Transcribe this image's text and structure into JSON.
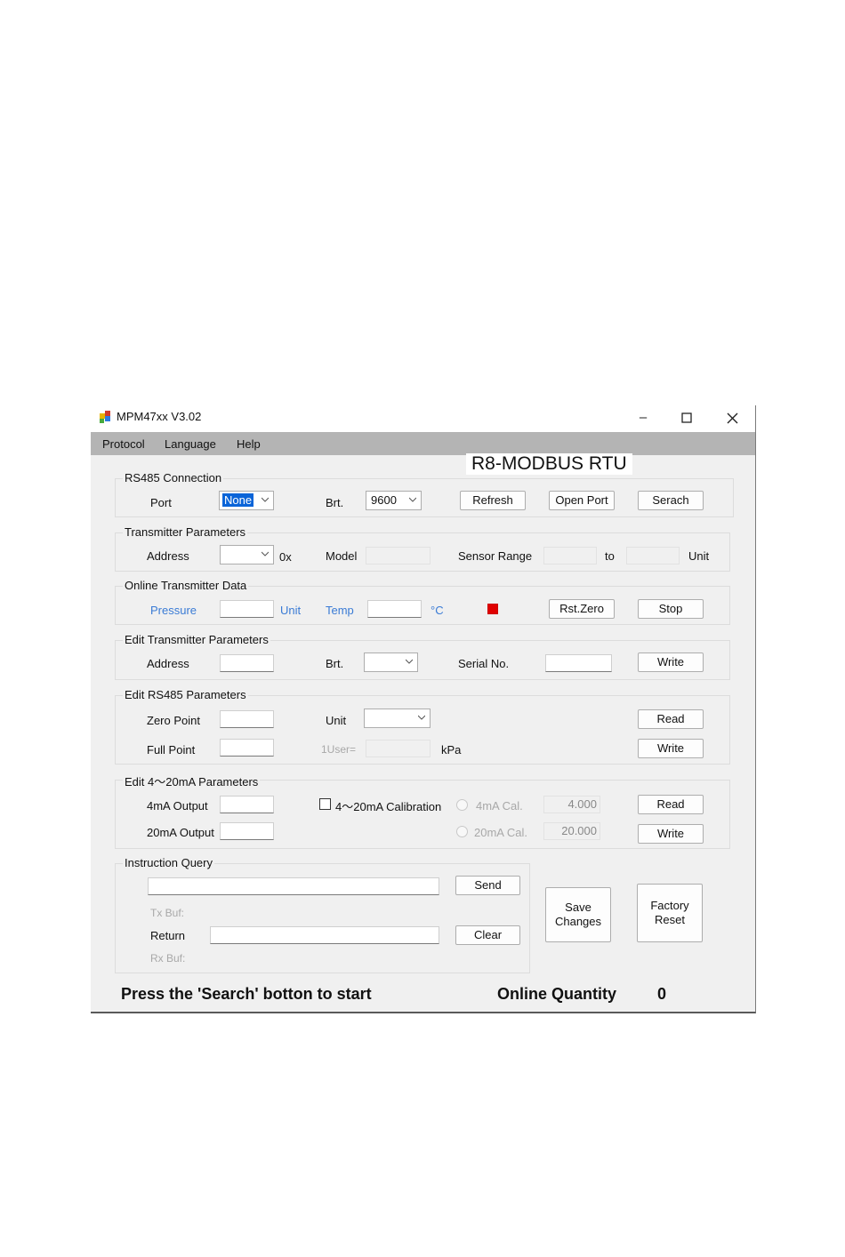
{
  "window": {
    "title": "MPM47xx V3.02"
  },
  "menu": [
    "Protocol",
    "Language",
    "Help"
  ],
  "mode_title": "R8-MODBUS RTU",
  "rs485_connection": {
    "label": "RS485 Connection",
    "port_label": "Port",
    "port_value": "None",
    "brt_label": "Brt.",
    "brt_value": "9600",
    "refresh": "Refresh",
    "open_port": "Open Port",
    "search": "Serach"
  },
  "transmitter_parameters": {
    "label": "Transmitter Parameters",
    "address_label": "Address",
    "address_prefix": "0x",
    "model_label": "Model",
    "sensor_range_label": "Sensor Range",
    "to_label": "to",
    "unit_label": "Unit"
  },
  "online_data": {
    "label": "Online Transmitter Data",
    "pressure_label": "Pressure",
    "unit_label": "Unit",
    "temp_label": "Temp",
    "temp_unit": "°C",
    "status_color": "#e00000",
    "rst_zero": "Rst.Zero",
    "stop": "Stop"
  },
  "edit_transmitter": {
    "label": "Edit Transmitter Parameters",
    "address_label": "Address",
    "brt_label": "Brt.",
    "serial_label": "Serial No.",
    "write": "Write"
  },
  "edit_rs485": {
    "label": "Edit RS485 Parameters",
    "zero_point_label": "Zero Point",
    "unit_label": "Unit",
    "read": "Read",
    "full_point_label": "Full Point",
    "user_label": "1User=",
    "kpa_label": "kPa",
    "write": "Write"
  },
  "edit_4_20": {
    "label": "Edit 4～20mA Parameters",
    "out4_label": "4mA Output",
    "calibration_label": "4～20mA Calibration",
    "cal4_label": "4mA Cal.",
    "cal4_value": "4.000",
    "read": "Read",
    "out20_label": "20mA Output",
    "cal20_label": "20mA Cal.",
    "cal20_value": "20.000",
    "write": "Write"
  },
  "instruction_query": {
    "label": "Instruction Query",
    "send": "Send",
    "tx_label": "Tx Buf:",
    "return_label": "Return",
    "clear": "Clear",
    "rx_label": "Rx Buf:"
  },
  "actions": {
    "save_line1": "Save",
    "save_line2": "Changes",
    "factory_line1": "Factory",
    "factory_line2": "Reset"
  },
  "status": {
    "message": "Press the 'Search' botton to start",
    "online_label": "Online  Quantity",
    "online_count": "0"
  }
}
